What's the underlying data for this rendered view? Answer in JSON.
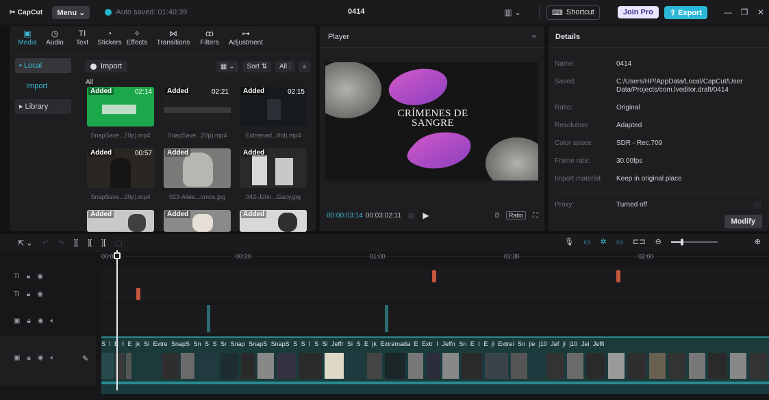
{
  "topbar": {
    "logo": "CapCut",
    "menu": "Menu",
    "autosave": "Auto saved: 01:40:39",
    "project": "0414",
    "shortcut": "Shortcut",
    "join_pro": "Join Pro",
    "export": "Export"
  },
  "tools": [
    {
      "label": "Media",
      "icon": "media-icon"
    },
    {
      "label": "Audio",
      "icon": "audio-icon"
    },
    {
      "label": "Text",
      "icon": "text-icon"
    },
    {
      "label": "Stickers",
      "icon": "stickers-icon"
    },
    {
      "label": "Effects",
      "icon": "effects-icon"
    },
    {
      "label": "Transitions",
      "icon": "transitions-icon"
    },
    {
      "label": "Filters",
      "icon": "filters-icon"
    },
    {
      "label": "Adjustment",
      "icon": "adjustment-icon"
    }
  ],
  "sidebar": {
    "local": "• Local",
    "import": "Import",
    "library": "▸ Library"
  },
  "media_toolbar": {
    "import": "Import",
    "sort": "Sort",
    "all": "All",
    "all_label": "All"
  },
  "media": [
    {
      "added": "Added",
      "duration": "02:14",
      "name": "SnapSave...20p).mp4"
    },
    {
      "added": "Added",
      "duration": "02:21",
      "name": "SnapSave...20p).mp4"
    },
    {
      "added": "Added",
      "duration": "02:15",
      "name": "Extremad...ñol).mp4"
    },
    {
      "added": "Added",
      "duration": "00:57",
      "name": "SnapSave...20p).mp4"
    },
    {
      "added": "Added",
      "duration": "",
      "name": "023-Ailee...omos.jpg"
    },
    {
      "added": "Added",
      "duration": "",
      "name": "042-John...Gacy.jpg"
    },
    {
      "added": "Added",
      "duration": "",
      "name": ""
    },
    {
      "added": "Added",
      "duration": "",
      "name": ""
    },
    {
      "added": "Added",
      "duration": "",
      "name": ""
    }
  ],
  "player": {
    "title": "Player",
    "video_title": "CRÍMENES DE SANGRE",
    "current": "00:00:03:14",
    "total": "00:03:02:11",
    "ratio": "Ratio"
  },
  "details": {
    "title": "Details",
    "rows": [
      {
        "k": "Name:",
        "v": "0414"
      },
      {
        "k": "Saved:",
        "v": "C:/Users/HP/AppData/Local/CapCut/User Data/Projects/com.lveditor.draft/0414"
      },
      {
        "k": "Ratio:",
        "v": "Original"
      },
      {
        "k": "Resolution:",
        "v": "Adapted"
      },
      {
        "k": "Color space:",
        "v": "SDR - Rec.709"
      },
      {
        "k": "Frame rate:",
        "v": "30.00fps"
      },
      {
        "k": "Import material:",
        "v": "Keep in original place"
      },
      {
        "k": "Proxy:",
        "v": "Turned off"
      }
    ],
    "modify": "Modify"
  },
  "timeline": {
    "ticks": [
      "00:00",
      "00:30",
      "01:00",
      "01:30",
      "02:00"
    ],
    "main_labels": "S  l  E  I  E  jk  Si  Extre  SnapS  Sn  S  S  Sr  Snap  SnapS  SnapS  S  S  I  S  Si  Jeffr  Si  S  E  jk  Extremada  E  Extr  I  Jeffn  Sn  E  I  E  jl  Extrei  Sn  jle  j10  Jef  jl  j10  Jei  Jeffi"
  }
}
